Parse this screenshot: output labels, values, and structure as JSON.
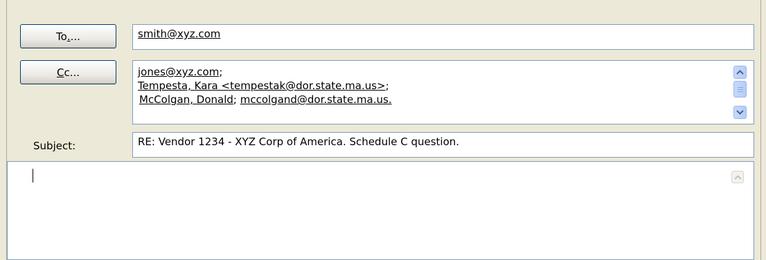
{
  "buttons": {
    "to": {
      "pre": "To",
      "mnemonic": ".",
      "post": "..."
    },
    "cc": {
      "pre": "",
      "mnemonic": "C",
      "post": "c..."
    }
  },
  "to_field": {
    "value": "smith@xyz.com"
  },
  "cc_field": {
    "lines": [
      {
        "recipient": "jones@xyz.com",
        "separator": ";"
      },
      {
        "recipient": "Tempesta, Kara <tempestak@dor.state.ma.us>",
        "separator": ";"
      },
      {
        "recipient_a": "McColgan, Donald",
        "separator": "; ",
        "recipient_b": "mccolgand@dor.state.ma.us."
      }
    ]
  },
  "subject": {
    "label_pre": "Sub",
    "label_mnemonic": "j",
    "label_post": "ect:",
    "value": "RE: Vendor 1234 - XYZ Corp of America.  Schedule C question."
  },
  "message_body": {
    "value": ""
  },
  "icons": {
    "scroll_up": "chevron-up-icon",
    "scroll_down": "chevron-down-icon"
  },
  "colors": {
    "window_bg": "#ece9d8",
    "field_border": "#7f9db9",
    "button_border": "#003c74",
    "scroll_accent": "#4d6185"
  }
}
